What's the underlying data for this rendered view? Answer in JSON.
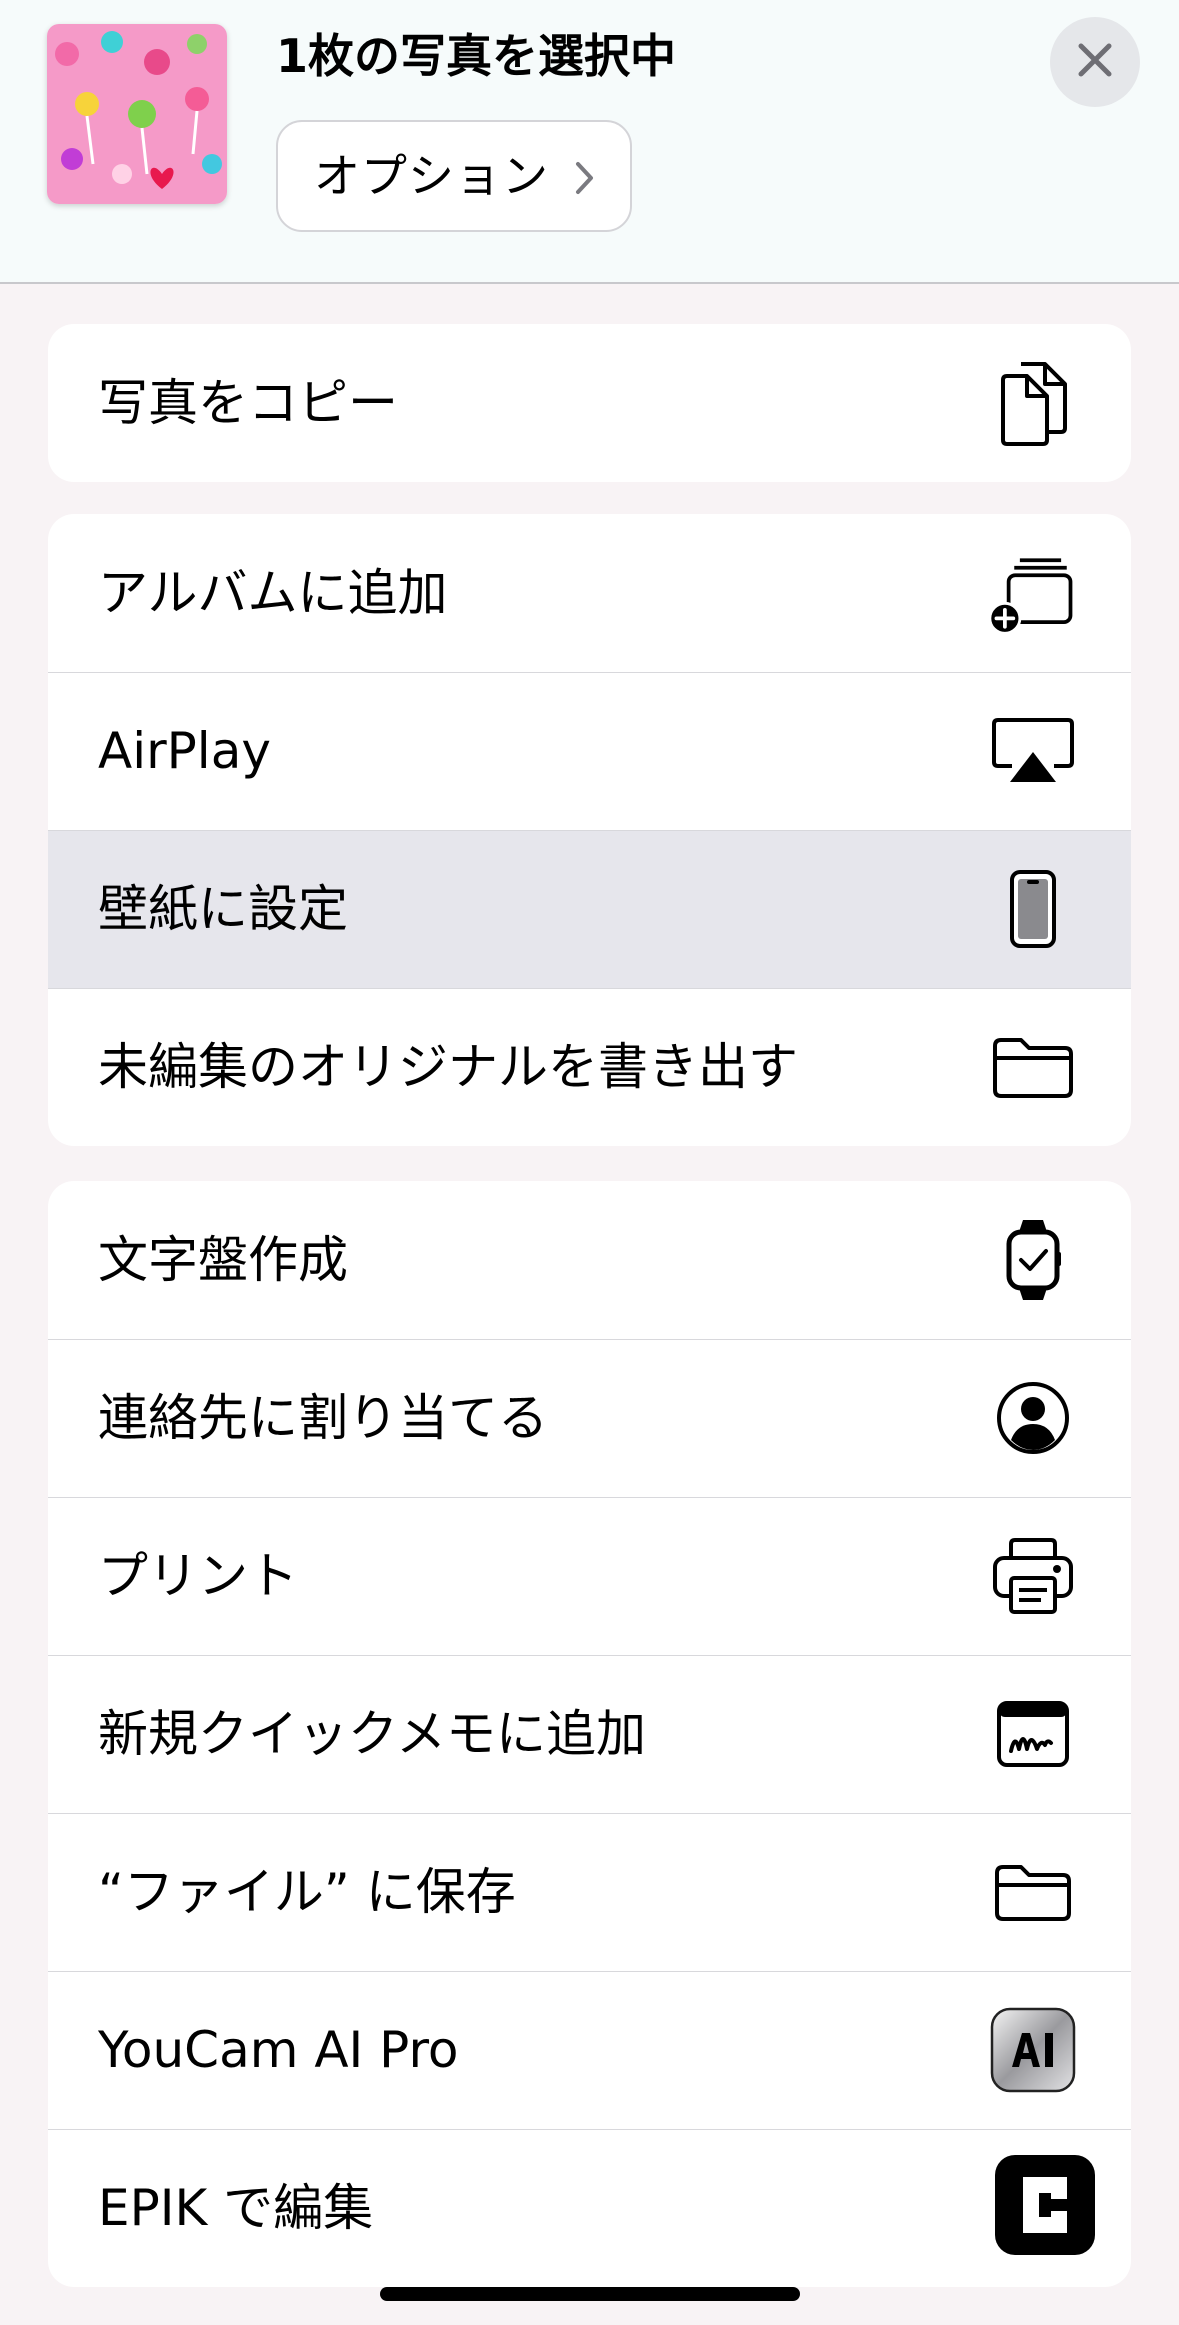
{
  "header": {
    "title": "1枚の写真を選択中",
    "options_label": "オプション"
  },
  "groups": [
    {
      "items": [
        {
          "label": "写真をコピー",
          "icon": "copy-icon"
        }
      ]
    },
    {
      "items": [
        {
          "label": "アルバムに追加",
          "icon": "add-to-album-icon"
        },
        {
          "label": "AirPlay",
          "icon": "airplay-icon"
        },
        {
          "label": "壁紙に設定",
          "icon": "iphone-icon",
          "highlighted": true
        },
        {
          "label": "未編集のオリジナルを書き出す",
          "icon": "folder-icon"
        }
      ]
    },
    {
      "items": [
        {
          "label": "文字盤作成",
          "icon": "watch-icon"
        },
        {
          "label": "連絡先に割り当てる",
          "icon": "contact-icon"
        },
        {
          "label": "プリント",
          "icon": "printer-icon"
        },
        {
          "label": "新規クイックメモに追加",
          "icon": "quick-note-icon"
        },
        {
          "label": "“ファイル” に保存",
          "icon": "folder-icon"
        },
        {
          "label": "YouCam AI Pro",
          "icon": "youcam-ai-pro-app-icon"
        },
        {
          "label": "EPIK で編集",
          "icon": "epik-app-icon"
        }
      ]
    }
  ],
  "colors": {
    "background": "#f8f3f5",
    "header_background": "#f6fbfb",
    "highlight": "#e6e6ec",
    "thumbnail_pink": "#f59ac8"
  }
}
